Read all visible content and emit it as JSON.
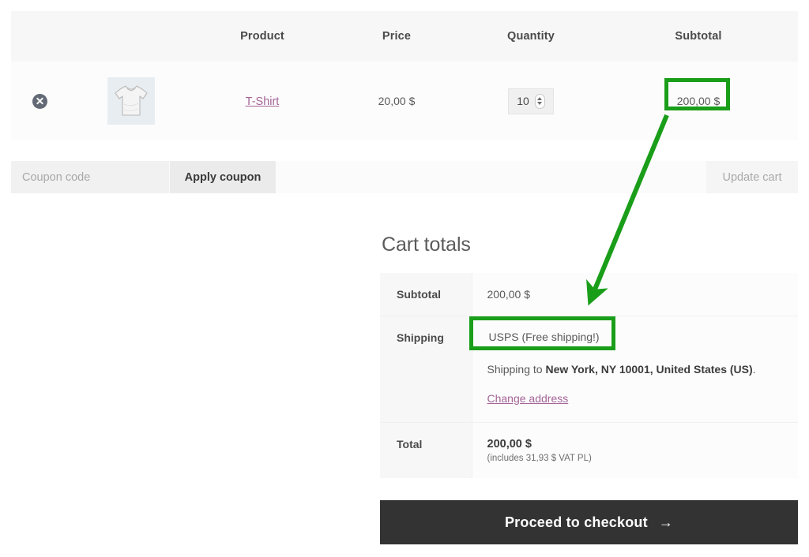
{
  "cart_table": {
    "headers": [
      "",
      "",
      "Product",
      "Price",
      "Quantity",
      "Subtotal"
    ],
    "rows": [
      {
        "remove_label": "Remove this item",
        "thumb_alt": "tshirt-thumbnail",
        "product": "T-Shirt",
        "price": "20,00 $",
        "quantity": "10",
        "subtotal": "200,00 $"
      }
    ]
  },
  "coupon": {
    "placeholder": "Coupon code",
    "value": "",
    "apply_label": "Apply coupon",
    "update_label": "Update cart"
  },
  "totals": {
    "title": "Cart totals",
    "subtotal_label": "Subtotal",
    "subtotal_value": "200,00 $",
    "shipping_label": "Shipping",
    "shipping_method": "USPS (Free shipping!)",
    "shipping_to_prefix": "Shipping to ",
    "shipping_to_address": "New York, NY 10001, United States (US)",
    "shipping_to_suffix": ".",
    "change_address_label": "Change address",
    "total_label": "Total",
    "total_value": "200,00 $",
    "total_note": "(includes 31,93 $ VAT PL)"
  },
  "checkout": {
    "label": "Proceed to checkout",
    "arrow": "→"
  },
  "annotations": {
    "highlight_color": "#1a9e1a",
    "boxes": [
      "subtotal-cell",
      "shipping-method"
    ],
    "arrow_from": "subtotal-cell",
    "arrow_to": "shipping-method"
  },
  "colors": {
    "link": "#a46497",
    "header_bg": "#f7f7f7",
    "checkout_bg": "#333333",
    "highlight": "#1a9e1a"
  }
}
